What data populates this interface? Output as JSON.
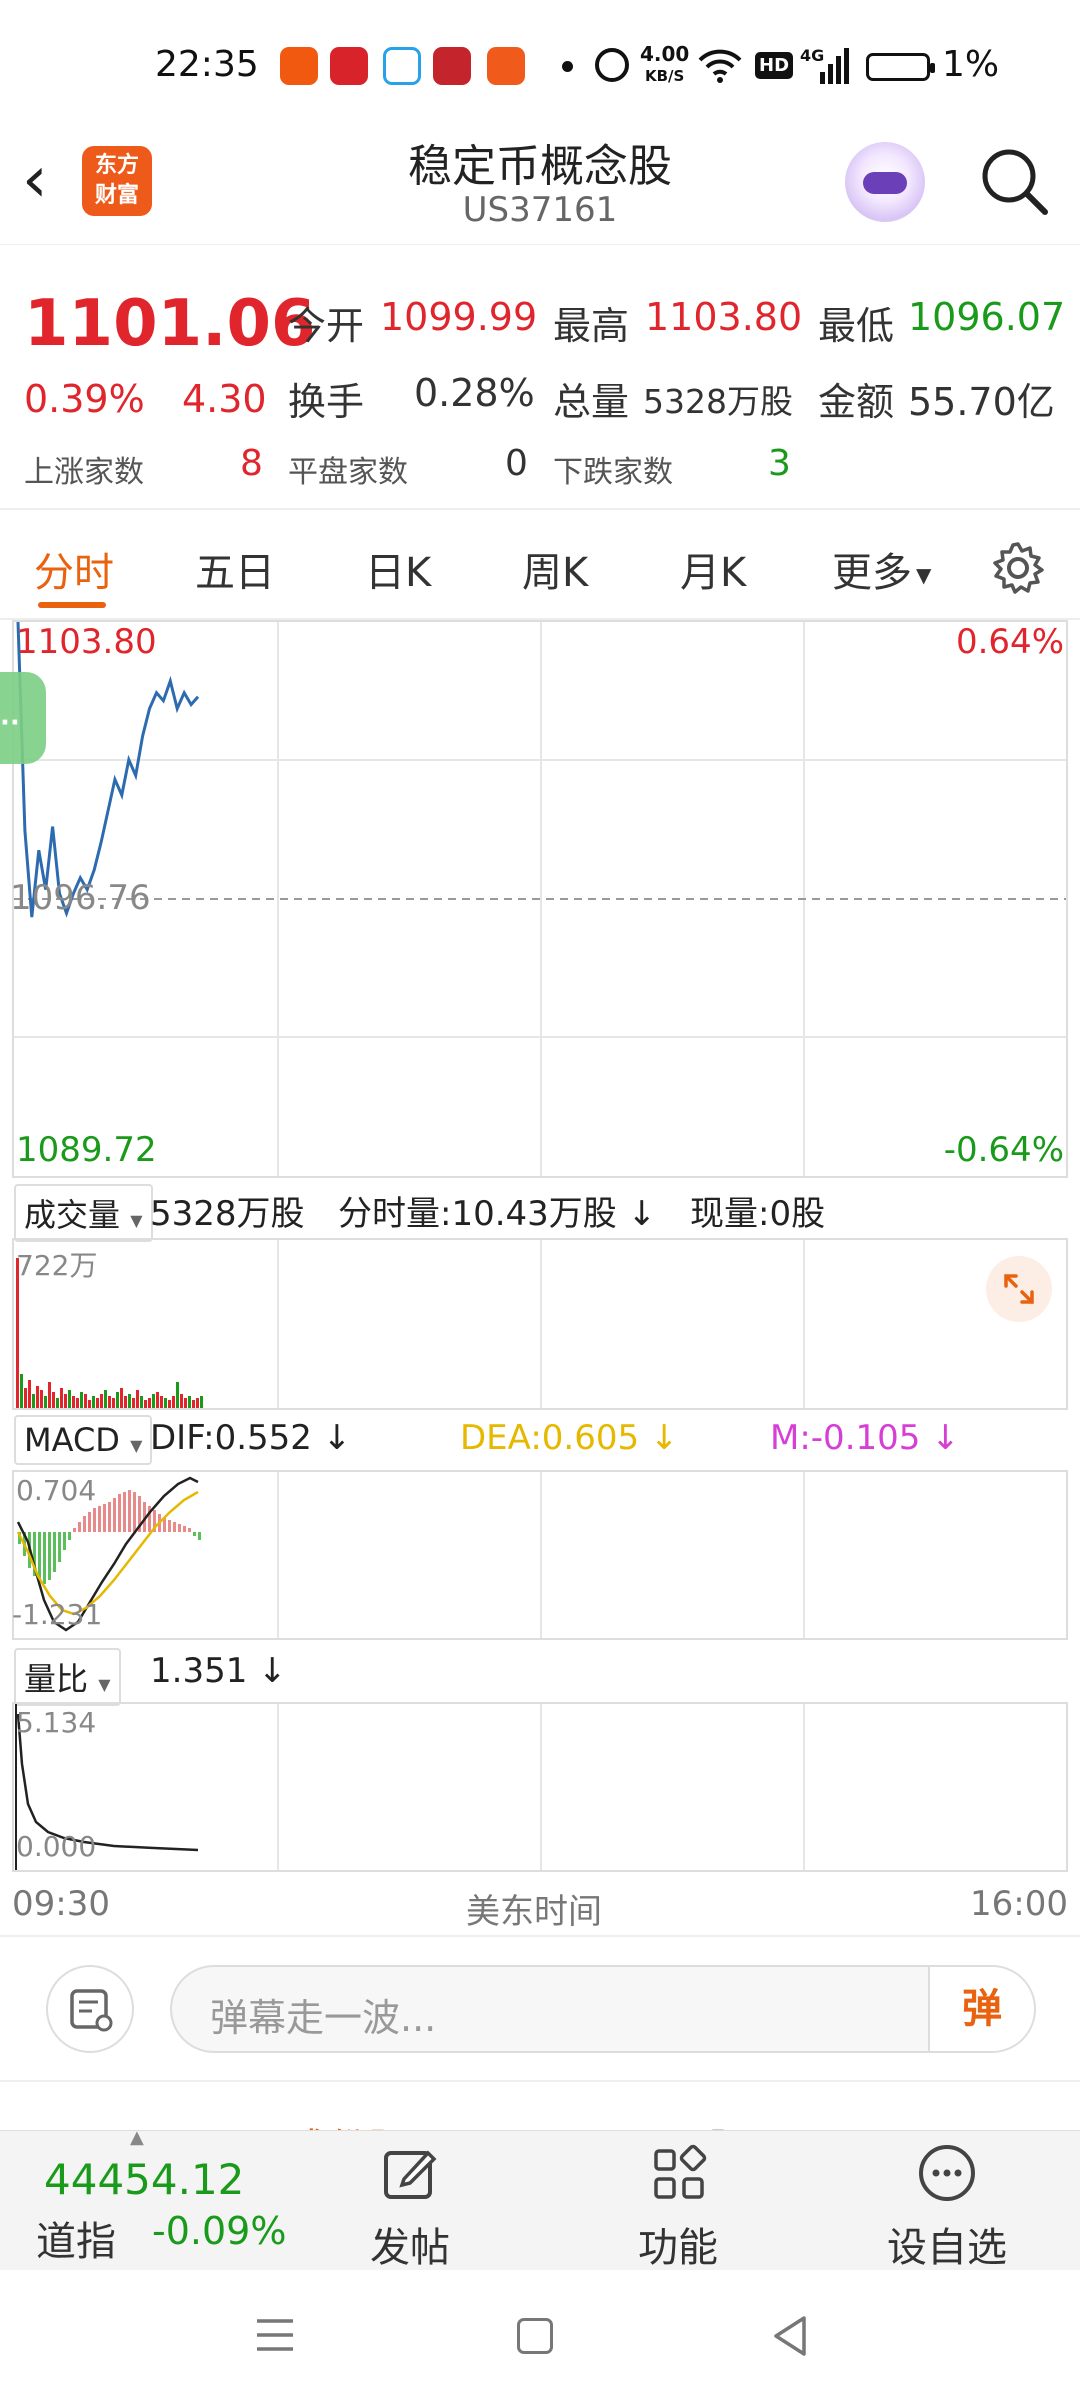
{
  "status_bar": {
    "time": "22:35",
    "network_speed": "4.00",
    "network_unit": "KB/S",
    "hd": "HD",
    "signal": "4G",
    "battery": "1%",
    "app_icons": [
      "feishu-icon",
      "app-red-icon",
      "app-blue-icon",
      "cctv-finance-icon",
      "taobao-icon"
    ]
  },
  "header": {
    "back": "‹",
    "logo_line1": "东方",
    "logo_line2": "财富",
    "title": "稳定币概念股",
    "code": "US37161"
  },
  "quote": {
    "price": "1101.06",
    "change_pct": "0.39%",
    "change": "4.30",
    "open_label": "今开",
    "open": "1099.99",
    "high_label": "最高",
    "high": "1103.80",
    "low_label": "最低",
    "low": "1096.07",
    "turnover_label": "换手",
    "turnover": "0.28%",
    "volume_label": "总量",
    "volume": "5328万股",
    "amount_label": "金额",
    "amount": "55.70亿",
    "up_label": "上涨家数",
    "up": "8",
    "flat_label": "平盘家数",
    "flat": "0",
    "down_label": "下跌家数",
    "down": "3"
  },
  "tabs": [
    "分时",
    "五日",
    "日K",
    "周K",
    "月K",
    "更多"
  ],
  "active_tab": "分时",
  "chart": {
    "price_top": "1103.80",
    "price_mid": "1096.76",
    "price_bottom": "1089.72",
    "pct_top": "0.64%",
    "pct_bottom": "-0.64%",
    "volume_select": "成交量",
    "volume_total": "5328万股",
    "minute_volume": "分时量:10.43万股",
    "current_volume": "现量:0股",
    "volume_max": "722万",
    "macd_select": "MACD",
    "dif": "DIF:0.552",
    "dea": "DEA:0.605",
    "m": "M:-0.105",
    "macd_top": "0.704",
    "macd_bottom": "-1.231",
    "ratio_select": "量比",
    "ratio_value": "1.351",
    "ratio_top": "5.134",
    "ratio_bottom": "0.000",
    "time_start": "09:30",
    "time_center": "美东时间",
    "time_end": "16:00"
  },
  "chart_data": {
    "type": "line",
    "title": "",
    "series": [
      {
        "values": [
          1103.8,
          1098.5,
          1096.3,
          1098.0,
          1097.0,
          1098.6,
          1096.9,
          1096.4,
          1096.9,
          1097.3,
          1097.0,
          1097.5,
          1098.2,
          1099.0,
          1099.8,
          1099.4,
          1100.3,
          1099.9,
          1100.9,
          1101.6,
          1102.0,
          1101.8,
          1102.3,
          1101.6,
          1102.0,
          1101.7,
          1101.9
        ]
      }
    ],
    "ylim": [
      1089.72,
      1103.8
    ],
    "reference": 1096.76,
    "x_range": [
      "09:30",
      "16:00"
    ]
  },
  "danmu": {
    "placeholder": "弹幕走一波...",
    "send": "弹"
  },
  "section_tabs": [
    "成份股",
    "股吧"
  ],
  "bottom_bar": {
    "index_value": "44454.12",
    "index_name": "道指",
    "index_change": "-0.09%",
    "post": "发帖",
    "functions": "功能",
    "watchlist": "设自选"
  },
  "colors": {
    "up": "#e0252c",
    "down": "#1a9a1a",
    "accent": "#e8620f",
    "line": "#2d6bb0",
    "dea": "#e6b800",
    "m": "#d63fd6"
  }
}
